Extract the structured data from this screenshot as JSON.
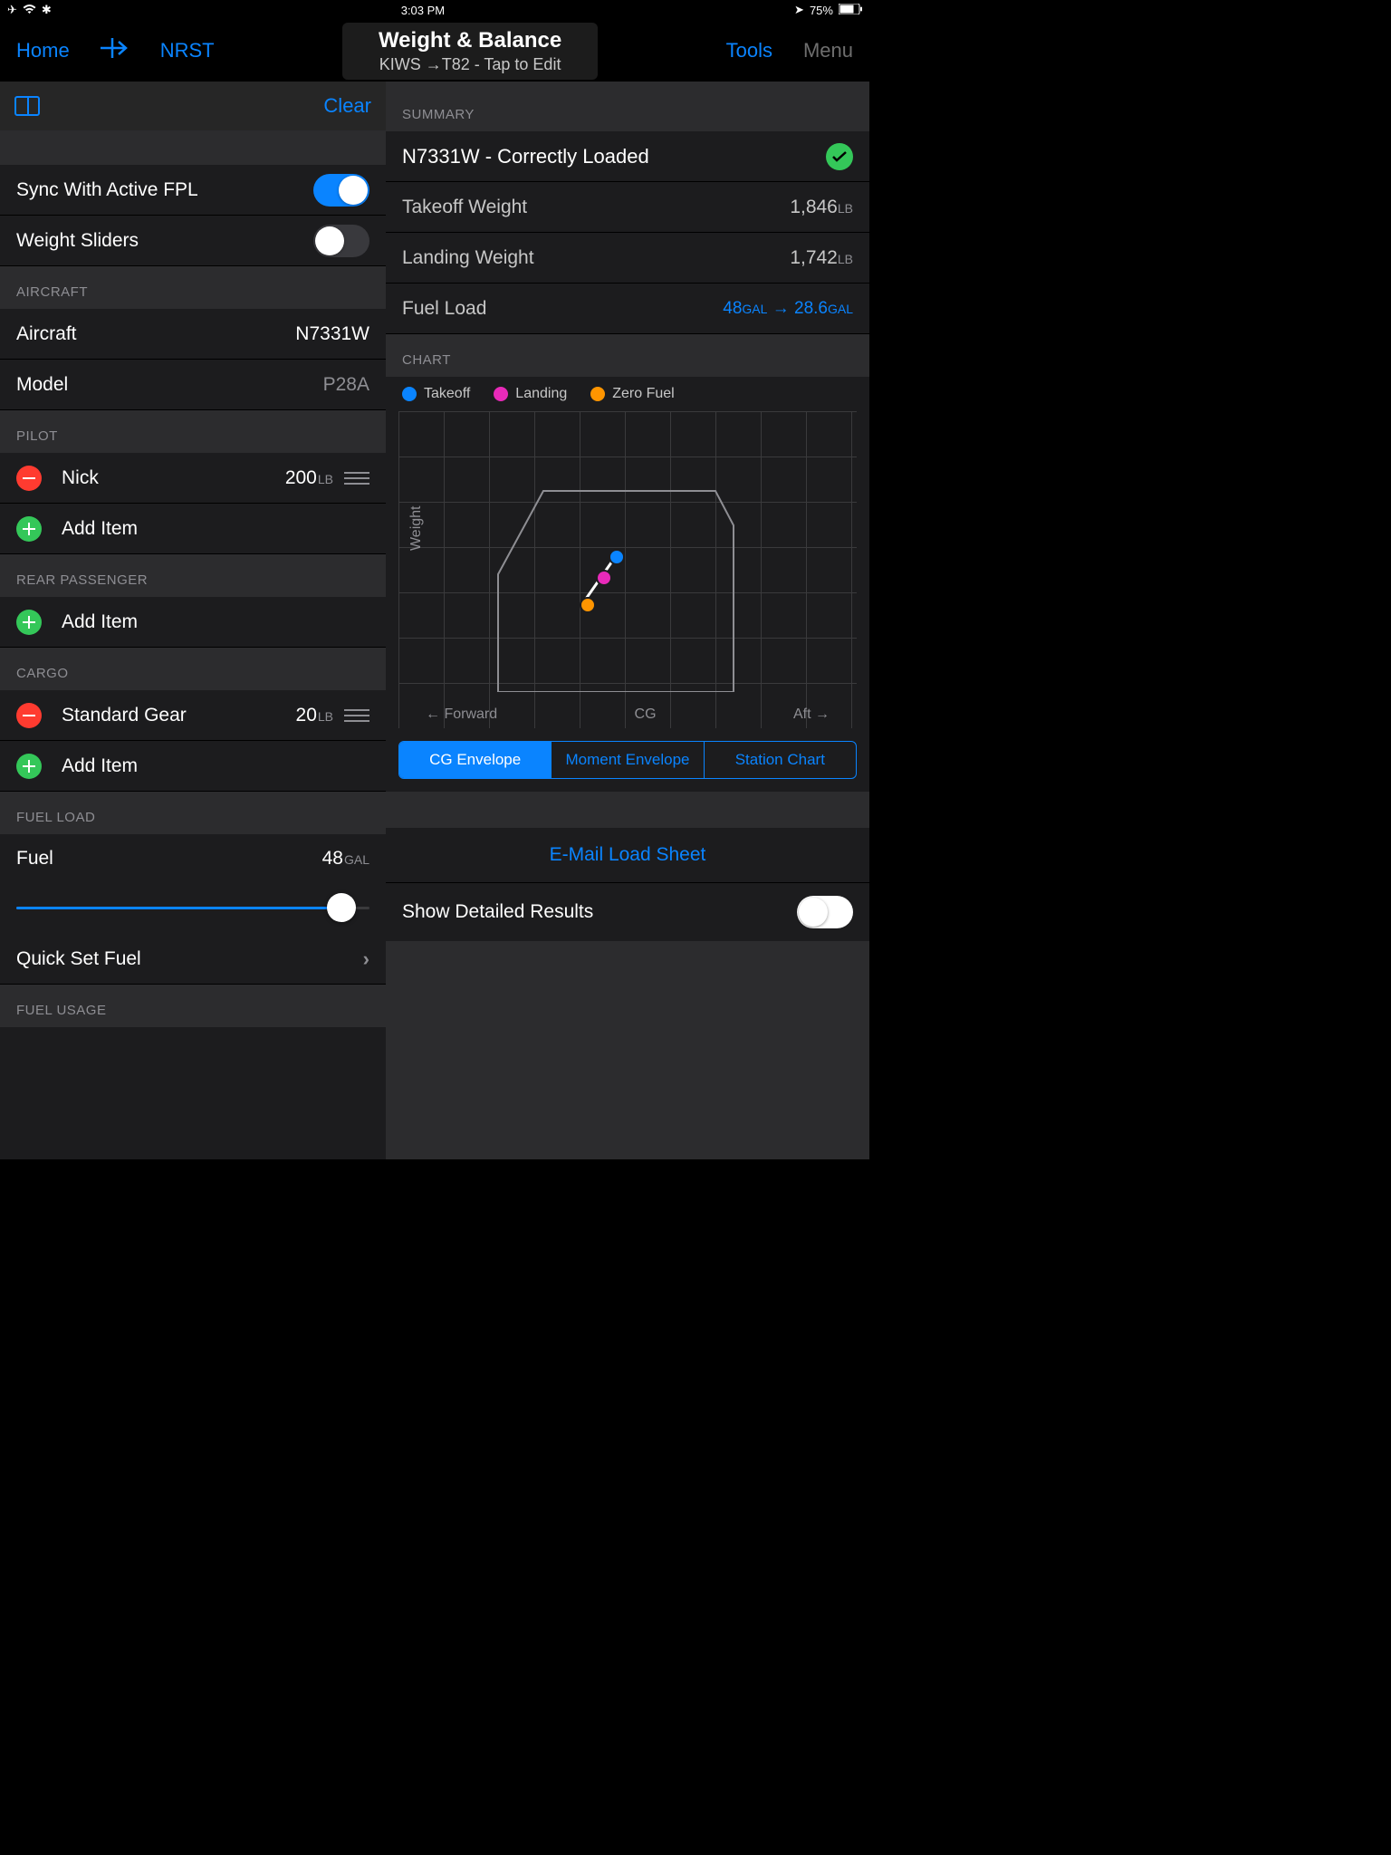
{
  "status": {
    "time": "3:03 PM",
    "battery": "75%"
  },
  "nav": {
    "home": "Home",
    "nrst": "NRST",
    "title": "Weight & Balance",
    "subtitle": "KIWS →T82 - Tap to Edit",
    "tools": "Tools",
    "menu": "Menu"
  },
  "left": {
    "clear": "Clear",
    "sync": "Sync With Active FPL",
    "sliders": "Weight Sliders",
    "aircraft_hdr": "AIRCRAFT",
    "aircraft_lbl": "Aircraft",
    "aircraft_val": "N7331W",
    "model_lbl": "Model",
    "model_val": "P28A",
    "pilot_hdr": "PILOT",
    "pilot_name": "Nick",
    "pilot_wt": "200",
    "pilot_unit": "LB",
    "add_item": "Add Item",
    "rear_hdr": "REAR PASSENGER",
    "cargo_hdr": "CARGO",
    "cargo_name": "Standard Gear",
    "cargo_wt": "20",
    "cargo_unit": "LB",
    "fuel_hdr": "FUEL LOAD",
    "fuel_lbl": "Fuel",
    "fuel_val": "48",
    "fuel_unit": "GAL",
    "quick_set": "Quick Set Fuel",
    "fuel_usage_hdr": "FUEL USAGE"
  },
  "right": {
    "summary_hdr": "SUMMARY",
    "status_line": "N7331W - Correctly Loaded",
    "to_lbl": "Takeoff Weight",
    "to_val": "1,846",
    "to_unit": "LB",
    "ld_lbl": "Landing Weight",
    "ld_val": "1,742",
    "ld_unit": "LB",
    "fl_lbl": "Fuel Load",
    "fl_start": "48",
    "fl_end": "28.6",
    "fl_unit": "GAL",
    "chart_hdr": "CHART",
    "legend": {
      "takeoff": "Takeoff",
      "landing": "Landing",
      "zero": "Zero Fuel"
    },
    "ylabel": "Weight",
    "forward": "← Forward",
    "cg": "CG",
    "aft": "Aft →",
    "seg": {
      "cg": "CG Envelope",
      "moment": "Moment Envelope",
      "station": "Station Chart"
    },
    "email": "E-Mail Load Sheet",
    "detail": "Show Detailed Results"
  },
  "chart_data": {
    "type": "scatter",
    "title": "CG Envelope",
    "xlabel": "CG",
    "ylabel": "Weight",
    "series": [
      {
        "name": "Takeoff",
        "color": "#0a84ff",
        "points": [
          {
            "cg_pct": 0.47,
            "weight_pct": 0.58
          }
        ]
      },
      {
        "name": "Landing",
        "color": "#e82ab9",
        "points": [
          {
            "cg_pct": 0.42,
            "weight_pct": 0.5
          }
        ]
      },
      {
        "name": "Zero Fuel",
        "color": "#ff9500",
        "points": [
          {
            "cg_pct": 0.36,
            "weight_pct": 0.39
          }
        ]
      }
    ],
    "envelope": [
      [
        0,
        1.0
      ],
      [
        0.2,
        1.0
      ],
      [
        0.95,
        1.0
      ],
      [
        0.95,
        0.0
      ],
      [
        0.03,
        0.0
      ],
      [
        0.03,
        0.52
      ],
      [
        0.2,
        1.0
      ]
    ]
  }
}
